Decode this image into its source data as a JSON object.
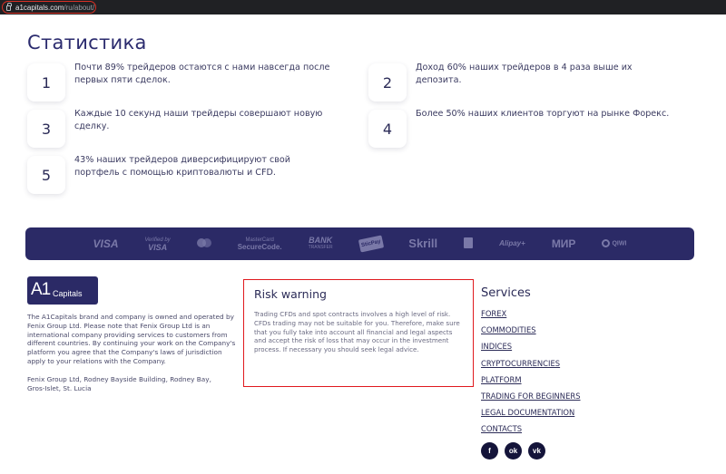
{
  "browser": {
    "url_host": "a1capitals.com",
    "url_path": "/ru/about/"
  },
  "stats": {
    "title": "Статистика",
    "items": [
      {
        "num": "1",
        "text": "Почти 89% трейдеров остаются с нами навсегда после первых пяти сделок."
      },
      {
        "num": "2",
        "text": "Доход 60% наших трейдеров в 4 раза выше их депозита."
      },
      {
        "num": "3",
        "text": "Каждые 10 секунд наши трейдеры совершают новую сделку."
      },
      {
        "num": "4",
        "text": "Более 50% наших клиентов торгуют на рынке Форекс."
      },
      {
        "num": "5",
        "text": "43% наших трейдеров диверсифицируют свой портфель с помощью криптовалюты и CFD."
      }
    ]
  },
  "payments": {
    "visa": "VISA",
    "verified_by_1": "Verified by",
    "verified_by_2": "VISA",
    "mastercard_1": "MasterCard",
    "mastercard_2": "SecureCode.",
    "bank_1": "BANK",
    "bank_2": "TRANSFER",
    "sticpay": "SticPay",
    "skrill": "Skrill",
    "alipay": "Alipay+",
    "mir": "МИР",
    "qiwi": "QIWI"
  },
  "footer": {
    "logo_main": "A1",
    "logo_sub": "Capitals",
    "about": "The A1Capitals brand and company is owned and operated by Fenix Group Ltd. Please note that Fenix Group Ltd is an international company providing services to customers from different countries. By continuing your work on the Company's platform you agree that the Company's laws of jurisdiction apply to your relations with the Company.",
    "address": "Fenix Group Ltd, Rodney Bayside Building, Rodney Bay, Gros-Islet, St. Lucia",
    "risk_title": "Risk warning",
    "risk_text": "Trading CFDs and spot contracts involves a high level of risk. CFDs trading may not be suitable for you. Therefore, make sure that you fully take into account all financial and legal aspects and accept the risk of loss that may occur in the investment process. If necessary you should seek legal advice.",
    "services_title": "Services",
    "services": [
      "FOREX",
      "COMMODITIES",
      "INDICES",
      "CRYPTOCURRENCIES",
      "PLATFORM",
      "TRADING FOR BEGINNERS",
      "LEGAL DOCUMENTATION",
      "CONTACTS"
    ],
    "social": {
      "facebook": "f",
      "odnoklassniki": "ok",
      "vk": "vk"
    }
  }
}
